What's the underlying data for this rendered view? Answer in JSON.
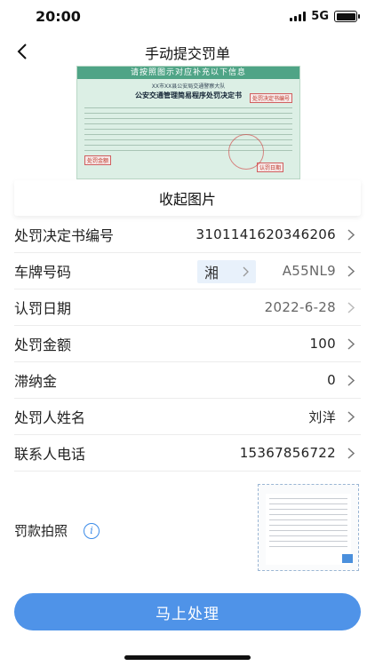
{
  "status_bar": {
    "time": "20:00",
    "network": "5G"
  },
  "nav": {
    "title": "手动提交罚单"
  },
  "ticket_image": {
    "header": "请按照图示对应补充以下信息",
    "sub": "XX市XX县公安局交通警察大队",
    "title": "公安交通管理简易程序处罚决定书",
    "label_decision": "处罚决定书编号",
    "label_amount": "处罚金额",
    "label_date": "认罚日期"
  },
  "collapse_label": "收起图片",
  "form": {
    "decision_no": {
      "label": "处罚决定书编号",
      "value": "3101141620346206"
    },
    "plate": {
      "label": "车牌号码",
      "prefix": "湘",
      "value": "A55NL9"
    },
    "date": {
      "label": "认罚日期",
      "value": "2022-6-28"
    },
    "amount": {
      "label": "处罚金额",
      "value": "100"
    },
    "late_fee": {
      "label": "滞纳金",
      "value": "0"
    },
    "name": {
      "label": "处罚人姓名",
      "value": "刘洋"
    },
    "phone": {
      "label": "联系人电话",
      "value": "15367856722"
    }
  },
  "photo": {
    "label": "罚款拍照"
  },
  "submit_label": "马上处理",
  "colors": {
    "accent": "#4f93e8",
    "ticket_green": "#4fa486"
  }
}
